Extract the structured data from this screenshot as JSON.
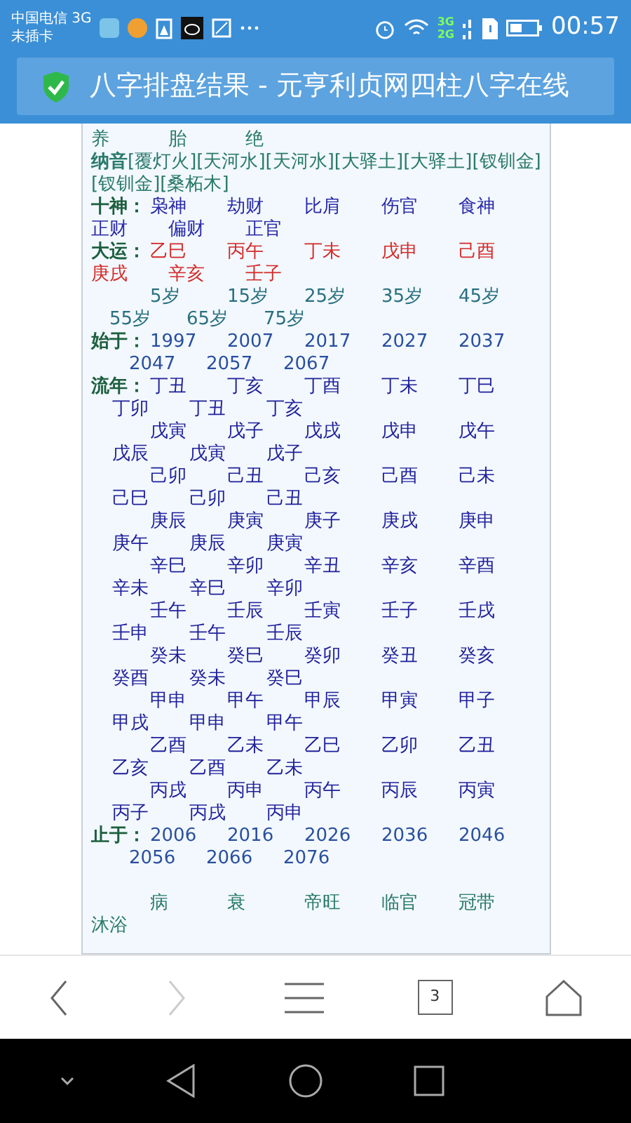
{
  "status_bar": {
    "carrier": "中国电信 3G",
    "sim": "未插卡",
    "network_labels": [
      "3G",
      "2G"
    ],
    "time": "00:57"
  },
  "title_bar": {
    "title": "八字排盘结果 - 元亨利贞网四柱八字在线"
  },
  "sections": [
    {
      "kind": "phase_tail",
      "items": [
        "养",
        "胎",
        "绝"
      ]
    },
    {
      "kind": "nayin",
      "text": "**纳音**[覆灯火][天河水][天河水][大驿土][大驿土][钗钏金][钗钏金][桑柘木]"
    },
    {
      "kind": "shishen",
      "label": "十神：",
      "items": [
        "枭神",
        "劫财",
        "比肩",
        "伤官",
        "食神",
        "正财",
        "偏财",
        "正官"
      ]
    },
    {
      "kind": "dayun",
      "label": "大运：",
      "items": [
        "乙巳",
        "丙午",
        "丁未",
        "戊申",
        "己酉",
        "庚戌",
        "辛亥",
        "壬子"
      ]
    },
    {
      "kind": "age",
      "items": [
        "5岁",
        "15岁",
        "25岁",
        "35岁",
        "45岁",
        "55岁",
        "65岁",
        "75岁"
      ]
    },
    {
      "kind": "year",
      "label": "始于：",
      "items": [
        "1997",
        "2007",
        "2017",
        "2027",
        "2037",
        "2047",
        "2057",
        "2067"
      ]
    },
    {
      "kind": "liunian",
      "label": "流年：",
      "items": [
        "丁丑",
        "丁亥",
        "丁酉",
        "丁未",
        "丁巳",
        "丁卯",
        "丁丑",
        "丁亥"
      ]
    },
    {
      "kind": "liunian",
      "items": [
        "戊寅",
        "戊子",
        "戊戌",
        "戊申",
        "戊午",
        "戊辰",
        "戊寅",
        "戊子"
      ]
    },
    {
      "kind": "liunian",
      "items": [
        "己卯",
        "己丑",
        "己亥",
        "己酉",
        "己未",
        "己巳",
        "己卯",
        "己丑"
      ]
    },
    {
      "kind": "liunian",
      "items": [
        "庚辰",
        "庚寅",
        "庚子",
        "庚戌",
        "庚申",
        "庚午",
        "庚辰",
        "庚寅"
      ]
    },
    {
      "kind": "liunian",
      "items": [
        "辛巳",
        "辛卯",
        "辛丑",
        "辛亥",
        "辛酉",
        "辛未",
        "辛巳",
        "辛卯"
      ]
    },
    {
      "kind": "liunian",
      "items": [
        "壬午",
        "壬辰",
        "壬寅",
        "壬子",
        "壬戌",
        "壬申",
        "壬午",
        "壬辰"
      ]
    },
    {
      "kind": "liunian",
      "items": [
        "癸未",
        "癸巳",
        "癸卯",
        "癸丑",
        "癸亥",
        "癸酉",
        "癸未",
        "癸巳"
      ]
    },
    {
      "kind": "liunian",
      "items": [
        "甲申",
        "甲午",
        "甲辰",
        "甲寅",
        "甲子",
        "甲戌",
        "甲申",
        "甲午"
      ]
    },
    {
      "kind": "liunian",
      "items": [
        "乙酉",
        "乙未",
        "乙巳",
        "乙卯",
        "乙丑",
        "乙亥",
        "乙酉",
        "乙未"
      ]
    },
    {
      "kind": "liunian",
      "items": [
        "丙戌",
        "丙申",
        "丙午",
        "丙辰",
        "丙寅",
        "丙子",
        "丙戌",
        "丙申"
      ]
    },
    {
      "kind": "year",
      "label": "止于：",
      "items": [
        "2006",
        "2016",
        "2026",
        "2036",
        "2046",
        "2056",
        "2066",
        "2076"
      ]
    },
    {
      "kind": "phase",
      "gap": true,
      "items": [
        "病",
        "衰",
        "帝旺",
        "临官",
        "冠带",
        "沐浴"
      ]
    }
  ],
  "toolbar": {
    "forward_disabled": true,
    "tab_count": "3"
  }
}
